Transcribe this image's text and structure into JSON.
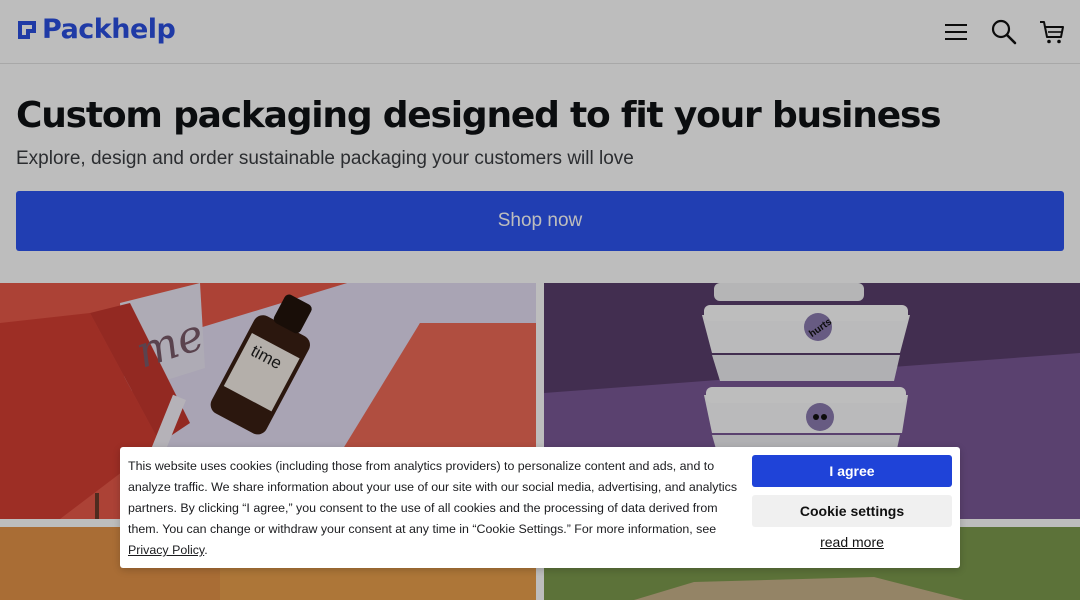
{
  "header": {
    "logo_text": "Packhelp",
    "brand_color": "#2a4fe0",
    "icons": [
      "menu-icon",
      "search-icon",
      "cart-icon"
    ]
  },
  "hero": {
    "title": "Custom packaging designed to fit your business",
    "subtitle": "Explore, design and order sustainable packaging your customers will love",
    "cta_label": "Shop now",
    "cta_color": "#2d54f0"
  },
  "gallery": {
    "tile1": {
      "bottle_label": "time",
      "box_text": "me"
    },
    "tile2": {
      "sticker_text": "hurts"
    }
  },
  "cookie_banner": {
    "text": "This website uses cookies (including those from analytics providers) to personalize content and ads, and to analyze traffic. We share information about your use of our site with our social media, advertising, and analytics partners. By clicking “I agree,” you consent to the use of all cookies and the processing of data derived from them. You can change or withdraw your consent at any time in “Cookie Settings.” For more information, see",
    "policy_link": "Privacy Policy",
    "agree_label": "I agree",
    "settings_label": "Cookie settings",
    "read_more_label": "read more",
    "agree_color": "#1f43d8"
  }
}
